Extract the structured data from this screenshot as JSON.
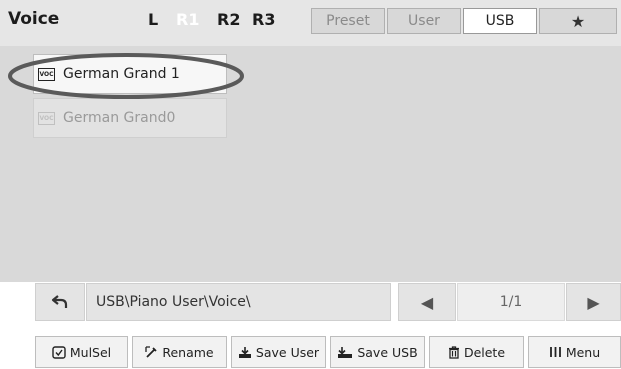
{
  "header": {
    "title": "Voice",
    "parts": [
      "L",
      "R1",
      "R2",
      "R3"
    ],
    "active_part": "R1",
    "tabs": [
      "Preset",
      "User",
      "USB"
    ],
    "selected_tab": "USB"
  },
  "list": {
    "items": [
      {
        "label": "German Grand 1",
        "icon": "voc-file-icon",
        "icon_text": "VOC",
        "selected": true
      },
      {
        "label": "German Grand0",
        "icon": "voc-file-icon",
        "icon_text": "VOC",
        "selected": false
      }
    ]
  },
  "path": {
    "value": "USB\\Piano User\\Voice\\"
  },
  "pager": {
    "indicator": "1/1"
  },
  "toolbar": {
    "mulsel": "MulSel",
    "rename": "Rename",
    "save_user": "Save User",
    "save_usb": "Save USB",
    "delete": "Delete",
    "menu": "Menu"
  },
  "colors": {
    "header_bg": "#e6e6e6",
    "list_bg": "#d9d9d9",
    "active_part": "#ffffff"
  }
}
